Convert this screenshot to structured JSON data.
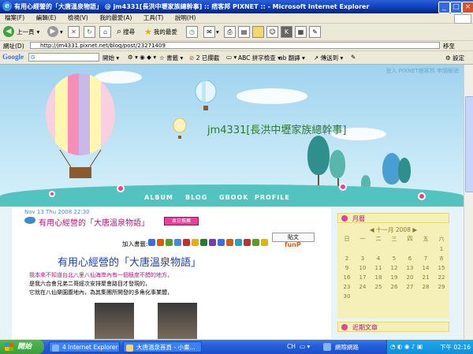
{
  "window": {
    "title": "有用心經營的「大唐溫泉物語」 @ jm4331[長洪中壢家族總幹事] :: 痞客邦 PIXNET :: - Microsoft Internet Explorer",
    "controls": {
      "minimize": "_",
      "maximize": "□",
      "close": "×"
    }
  },
  "menu": {
    "items": [
      "檔案(F)",
      "編輯(E)",
      "檢視(V)",
      "我的最愛(A)",
      "工具(T)",
      "說明(H)"
    ]
  },
  "toolbar": {
    "back_label": "上一頁",
    "search_label": "搜尋",
    "favorites_label": "我的最愛"
  },
  "address": {
    "label": "網址(D)",
    "url": "http://jm4331.pixnet.net/blog/post/23271409",
    "go_label": "移至"
  },
  "google_bar": {
    "logo": "Google",
    "search_value": "G",
    "start_label": "開始",
    "bookmarks_label": "書籤",
    "blocked_label": "2 已攔截",
    "spellcheck_label": "拼字檢查",
    "translate_label": "翻譯",
    "sendto_label": "傳送到",
    "settings_label": "設定"
  },
  "blog": {
    "login_links": "登入 PIXNET痞客邦 申請帳號",
    "title": "jm4331[長洪中壢家族總幹事]",
    "nav": [
      "ALBUM",
      "BLOG",
      "GBOOK",
      "PROFILE"
    ]
  },
  "post": {
    "date": "Nov 13 Thu 2008 22:30",
    "title": "有用心經營的「大唐溫泉物語」",
    "tag_badge": "本日推薦",
    "paste_label": "貼文",
    "bookmark_label": "加入書籤:",
    "funp_label": "funP",
    "article_title": "有用心經營的「大唐溫泉物語」",
    "lines": [
      "我本來不知道台北八里八仙海岸內有一個極度不錯的地方，",
      "是我六合會兄弟二哥經次安排聚會路目才發現的，",
      "它就在八仙樂園腹地內，為其集團所開發的多角化事業體，"
    ]
  },
  "sidebar": {
    "calendar_title": "月曆",
    "month_label": "十一月 2008",
    "weekdays": [
      "日",
      "一",
      "二",
      "三",
      "四",
      "五",
      "六"
    ],
    "weeks": [
      [
        "",
        "",
        "",
        "",
        "",
        "",
        "1"
      ],
      [
        "2",
        "3",
        "4",
        "5",
        "6",
        "7",
        "8"
      ],
      [
        "9",
        "10",
        "11",
        "12",
        "13",
        "14",
        "15"
      ],
      [
        "16",
        "17",
        "18",
        "19",
        "20",
        "21",
        "22"
      ],
      [
        "23",
        "24",
        "25",
        "26",
        "27",
        "28",
        "29"
      ],
      [
        "30",
        "",
        "",
        "",
        "",
        "",
        ""
      ]
    ],
    "recent_title": "近期文章"
  },
  "taskbar": {
    "start_label": "開始",
    "tasks": [
      "4 Internet Explorer",
      "大唐溫泉首頁 - 小畫..."
    ],
    "lang": "CH",
    "network_label": "網際網路",
    "clock": "下午 02:16"
  }
}
